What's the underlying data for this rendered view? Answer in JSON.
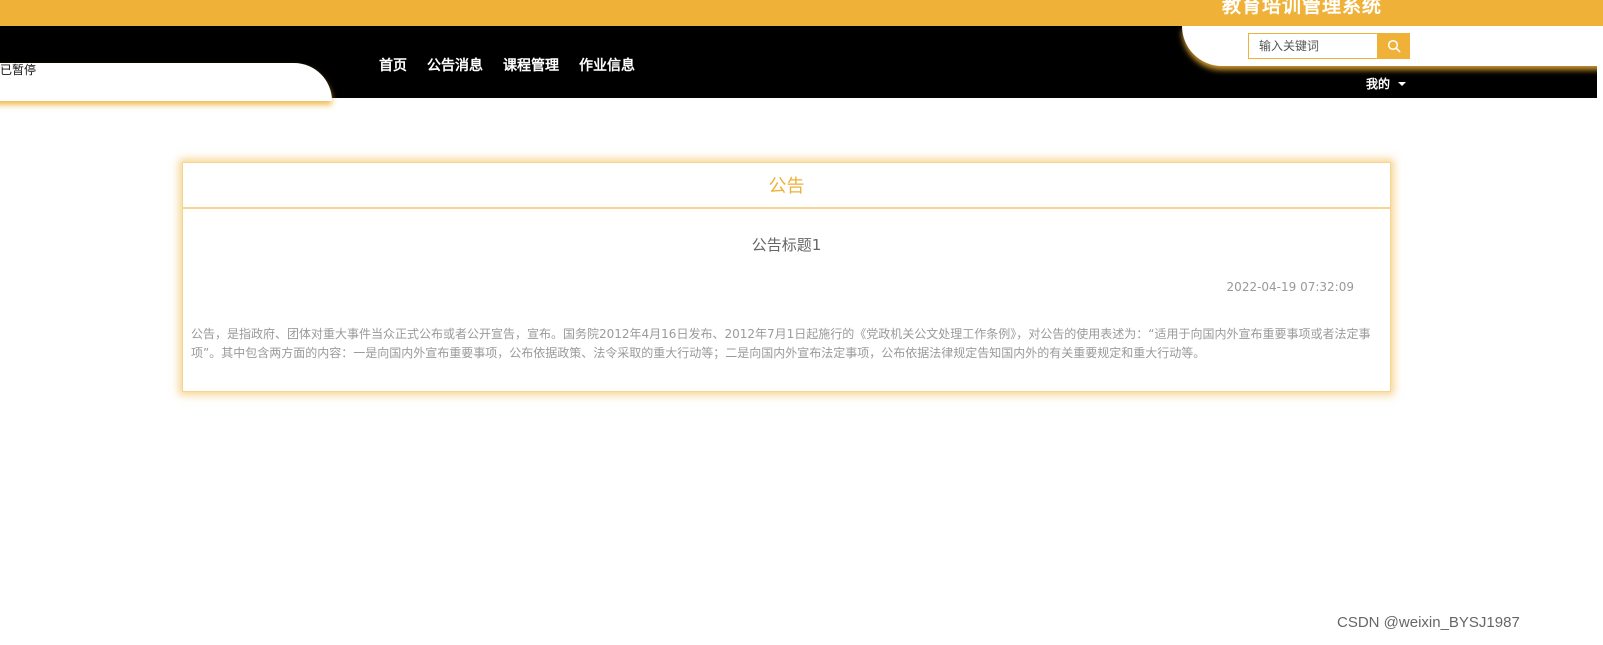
{
  "header": {
    "site_title": "教育培训管理系统",
    "paused_label": "已暂停",
    "nav": [
      {
        "label": "首页"
      },
      {
        "label": "公告消息"
      },
      {
        "label": "课程管理"
      },
      {
        "label": "作业信息"
      }
    ],
    "search": {
      "placeholder": "输入关键词"
    },
    "user_menu": "我的"
  },
  "notice": {
    "section_title": "公告",
    "title": "公告标题1",
    "time": "2022-04-19 07:32:09",
    "content": "公告，是指政府、团体对重大事件当众正式公布或者公开宣告，宣布。国务院2012年4月16日发布、2012年7月1日起施行的《党政机关公文处理工作条例》，对公告的使用表述为：“适用于向国内外宣布重要事项或者法定事项”。其中包含两方面的内容：一是向国内外宣布重要事项，公布依据政策、法令采取的重大行动等；二是向国内外宣布法定事项，公布依据法律规定告知国内外的有关重要规定和重大行动等。"
  },
  "watermark": "CSDN @weixin_BYSJ1987",
  "colors": {
    "accent": "#EFB137",
    "nav_bg": "#000000"
  },
  "icons": {
    "search": "search-icon",
    "dropdown": "caret-down-icon"
  }
}
